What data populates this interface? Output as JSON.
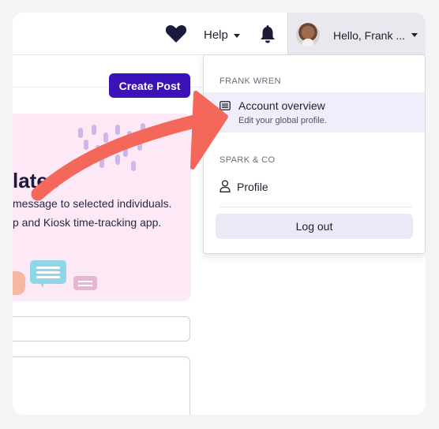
{
  "header": {
    "help_label": "Help",
    "greeting": "Hello, Frank ..."
  },
  "main": {
    "create_post_label": "Create Post",
    "hero_title": "lates",
    "hero_line1": "message to selected individuals.",
    "hero_line2": "p and Kiosk time-tracking app."
  },
  "dropdown": {
    "section1_label": "FRANK WREN",
    "account_overview_title": "Account overview",
    "account_overview_subtitle": "Edit your global profile.",
    "section2_label": "SPARK & CO",
    "profile_label": "Profile",
    "logout_label": "Log out"
  },
  "colors": {
    "accent": "#3a12b8",
    "highlight": "#efeefa",
    "hero_bg": "#fde9f6",
    "arrow": "#f4675b"
  },
  "icons": {
    "heart": "heart-icon",
    "bell": "bell-icon",
    "list": "list-icon",
    "person": "person-icon"
  }
}
